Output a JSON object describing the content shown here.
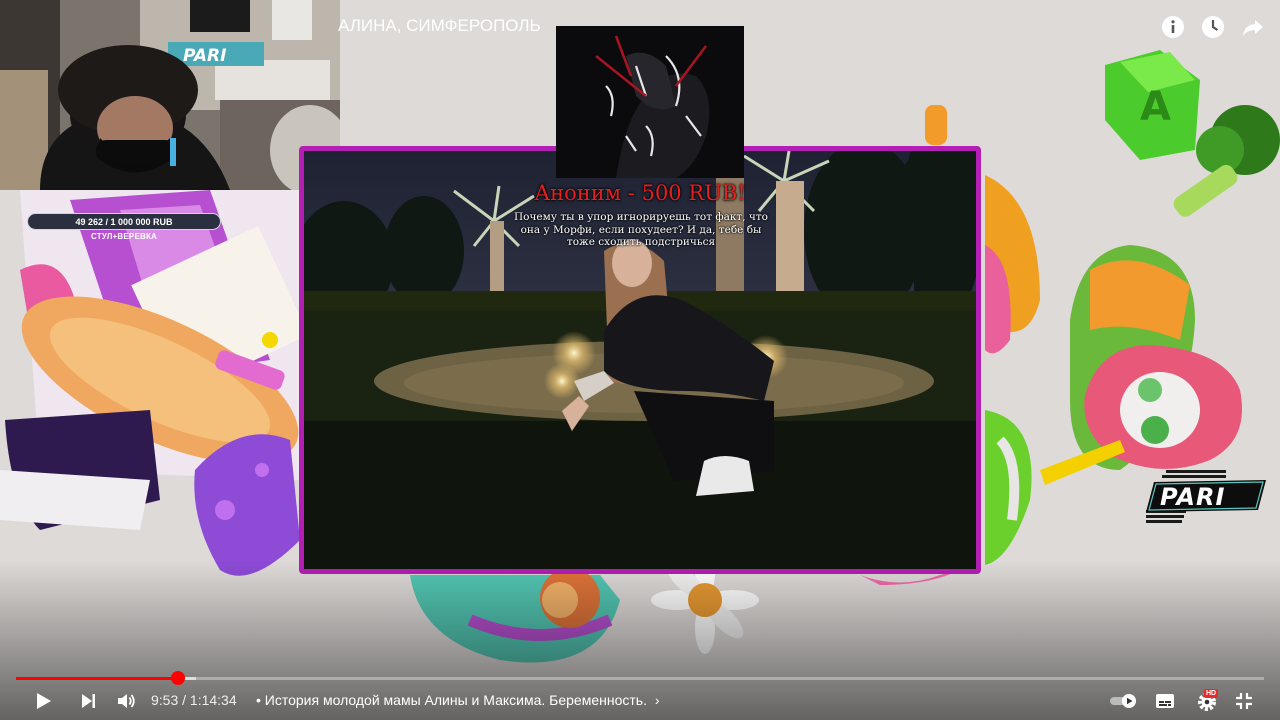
{
  "video": {
    "title": "АЛИНА, СИМФЕРОПОЛЬ"
  },
  "stream_overlay": {
    "goal_text": "49 262 / 1 000 000 RUB",
    "goal_label": "СТУЛ+ВЕРЕВКА",
    "goal_progress": 0.049,
    "sponsor_logo": "PARI",
    "webcam_banner": "PARI"
  },
  "donation": {
    "name_line": "Аноним - 500 RUB!",
    "message": "Почему ты в упор игнорируешь тот факт, что она у Морфи, если похудеет? И да, тебе бы тоже сходить подстричься"
  },
  "player": {
    "current_time": "9:53",
    "duration": "1:14:34",
    "time_text": "9:53 / 1:14:34",
    "chapter": "• История молодой мамы Алины и Максима. Беременность.",
    "chapter_chevron": "›",
    "progress_fraction": 0.13,
    "buffer_fraction": 0.144,
    "hd_badge": "HD",
    "accent_color": "#ff0000"
  },
  "icons": {
    "info": "info-icon",
    "watch_later": "clock-icon",
    "share": "share-icon",
    "play": "play-icon",
    "next": "next-icon",
    "volume": "volume-icon",
    "autoplay": "autoplay-toggle-icon",
    "subtitles": "subtitles-icon",
    "settings": "gear-icon",
    "exit_fullscreen": "exit-fullscreen-icon"
  },
  "colors": {
    "frame_border": "#b31fb5",
    "donation_name": "#e81e1e"
  }
}
